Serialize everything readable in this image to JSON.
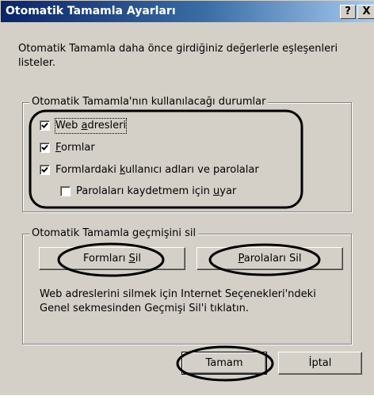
{
  "window": {
    "title": "Otomatik Tamamla Ayarları",
    "help_label": "?",
    "close_label": "X"
  },
  "description": "Otomatik Tamamla daha önce girdiğiniz değerlerle eşleşenleri listeler.",
  "usage_group": {
    "legend": "Otomatik Tamamla'nın kullanılacağı durumlar",
    "items": [
      {
        "pre": "",
        "mnemonic": "",
        "label": "Web ",
        "mn": "a",
        "post": "dresleri",
        "checked": true
      },
      {
        "pre": "",
        "mn": "F",
        "post": "ormlar",
        "checked": true
      },
      {
        "pre": "Formlardaki ",
        "mn": "k",
        "post": "ullanıcı adları ve parolalar",
        "checked": true
      },
      {
        "pre": "Parolaları kaydetmem için ",
        "mn": "u",
        "post": "yar",
        "checked": false
      }
    ]
  },
  "history_group": {
    "legend_pre": "Otomatik Tamamla ",
    "legend_mn": "g",
    "legend_post": "eçmişini sil",
    "clear_forms_pre": "Formları ",
    "clear_forms_mn": "S",
    "clear_forms_post": "il",
    "clear_passwords_pre": "",
    "clear_passwords_mn": "P",
    "clear_passwords_post": "arolaları Sil",
    "note": "Web adreslerini silmek için Internet Seçenekleri'ndeki Genel sekmesinden Geçmişi Sil'i tıklatın."
  },
  "footer": {
    "ok_label": "Tamam",
    "cancel_label": "İptal"
  },
  "colors": {
    "titlebar_start": "#0a246a",
    "titlebar_end": "#a6caf0",
    "face": "#d4d0c8",
    "annotation": "#000000"
  }
}
